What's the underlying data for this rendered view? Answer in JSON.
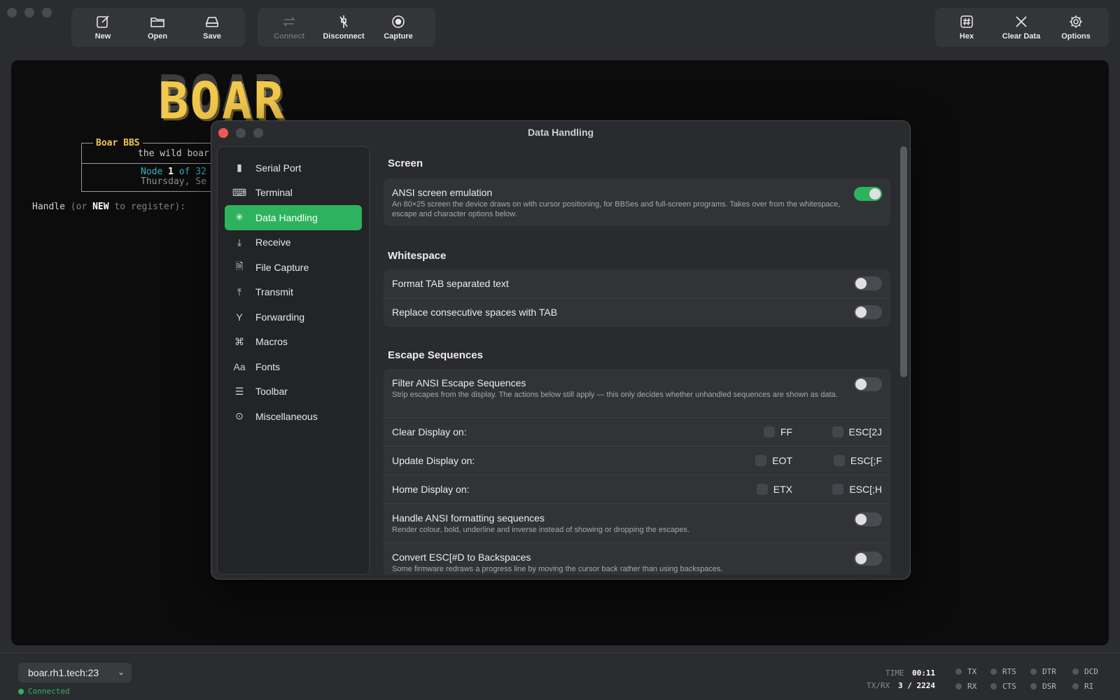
{
  "toolbar": {
    "file": [
      {
        "label": "New",
        "icon": "new-document-icon"
      },
      {
        "label": "Open",
        "icon": "folder-icon"
      },
      {
        "label": "Save",
        "icon": "save-drive-icon"
      }
    ],
    "connection": [
      {
        "label": "Connect",
        "icon": "connect-arrows-icon",
        "enabled": false
      },
      {
        "label": "Disconnect",
        "icon": "disconnect-icon",
        "enabled": true
      },
      {
        "label": "Capture",
        "icon": "capture-record-icon",
        "enabled": true
      }
    ],
    "right": [
      {
        "label": "Hex",
        "icon": "hex-icon"
      },
      {
        "label": "Clear Data",
        "icon": "clear-x-icon"
      },
      {
        "label": "Options",
        "icon": "gear-icon"
      }
    ]
  },
  "terminal": {
    "logo_text": "BOAR",
    "bbs_title": "Boar BBS",
    "bbs_subtitle": "the wild boar",
    "node_prefix": "Node",
    "node_num": "1",
    "node_of": "of",
    "node_total": "32",
    "date_text": "Thursday, Se",
    "prompt_start": "Handle",
    "prompt_dim1": "(or",
    "prompt_new": "NEW",
    "prompt_dim2": "to register):"
  },
  "dialog": {
    "title": "Data Handling",
    "sidebar": [
      {
        "label": "Serial Port",
        "icon": "plug-icon"
      },
      {
        "label": "Terminal",
        "icon": "keyboard-icon"
      },
      {
        "label": "Data Handling",
        "icon": "sparkle-icon",
        "active": true
      },
      {
        "label": "Receive",
        "icon": "download-arrow-icon"
      },
      {
        "label": "File Capture",
        "icon": "file-capture-icon"
      },
      {
        "label": "Transmit",
        "icon": "upload-arrow-icon"
      },
      {
        "label": "Forwarding",
        "icon": "fork-icon"
      },
      {
        "label": "Macros",
        "icon": "command-key-icon"
      },
      {
        "label": "Fonts",
        "icon": "font-aa-icon"
      },
      {
        "label": "Toolbar",
        "icon": "sliders-icon"
      },
      {
        "label": "Miscellaneous",
        "icon": "ellipsis-circle-icon"
      }
    ],
    "screen": {
      "title": "Screen",
      "ansi_label": "ANSI screen emulation",
      "ansi_desc": "An 80×25 screen the device draws on with cursor positioning, for BBSes and full-screen programs. Takes over from the whitespace, escape and character options below.",
      "ansi_on": true
    },
    "whitespace": {
      "title": "Whitespace",
      "tab_label": "Format TAB separated text",
      "spaces_label": "Replace consecutive spaces with TAB"
    },
    "escape": {
      "title": "Escape Sequences",
      "filter_label": "Filter ANSI Escape Sequences",
      "filter_desc": "Strip escapes from the display. The actions below still apply — this only decides whether unhandled sequences are shown as data.",
      "clear_label": "Clear Display on:",
      "clear_opt1": "FF",
      "clear_opt2": "ESC[2J",
      "update_label": "Update Display on:",
      "update_opt1": "EOT",
      "update_opt2": "ESC[;F",
      "home_label": "Home Display on:",
      "home_opt1": "ETX",
      "home_opt2": "ESC[;H",
      "format_label": "Handle ANSI formatting sequences",
      "format_desc": "Render colour, bold, underline and inverse instead of showing or dropping the escapes.",
      "convert_label": "Convert ESC[#D to Backspaces",
      "convert_desc": "Some firmware redraws a progress line by moving the cursor back rather than using backspaces."
    }
  },
  "status": {
    "host": "boar.rh1.tech:23",
    "connected": "Connected",
    "time_label": "TIME",
    "time_value": "00:11",
    "txrx_label": "TX/RX",
    "txrx_value": "3 / 2224",
    "leds": [
      "TX",
      "RTS",
      "DTR",
      "DCD",
      "RX",
      "CTS",
      "DSR",
      "RI"
    ]
  },
  "colors": {
    "accent": "#2db35d",
    "logo": "#f2c94c",
    "node": "#2ab7c7"
  }
}
